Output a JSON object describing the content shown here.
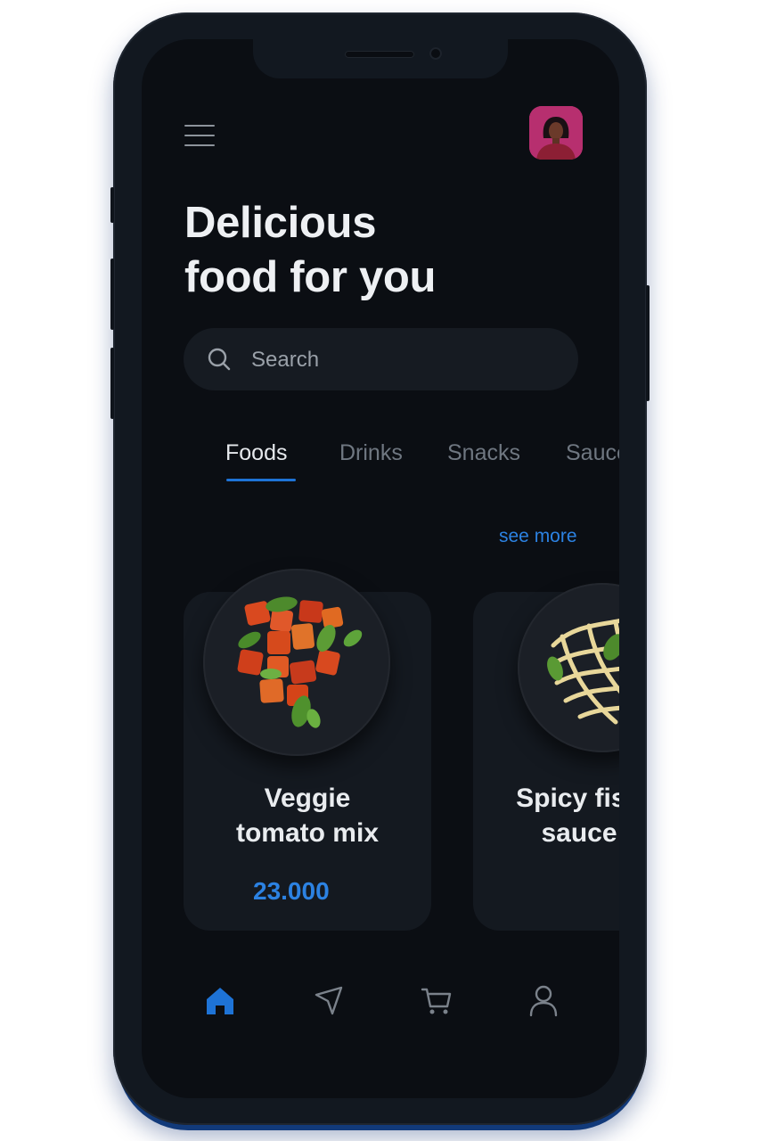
{
  "header": {
    "title_line1": "Delicious",
    "title_line2": "food for you"
  },
  "search": {
    "placeholder": "Search"
  },
  "tabs": [
    {
      "label": "Foods",
      "active": true
    },
    {
      "label": "Drinks",
      "active": false
    },
    {
      "label": "Snacks",
      "active": false
    },
    {
      "label": "Sauce",
      "active": false
    }
  ],
  "see_more": "see more",
  "products": [
    {
      "name_line1": "Veggie",
      "name_line2": "tomato mix",
      "price": "23.000",
      "image": "veggie-tomato-dish"
    },
    {
      "name_line1": "Spicy fish",
      "name_line2": "sauce",
      "image": "pasta-dish"
    }
  ],
  "bottom_nav": [
    {
      "icon": "home-icon",
      "active": true
    },
    {
      "icon": "send-icon",
      "active": false
    },
    {
      "icon": "cart-icon",
      "active": false
    },
    {
      "icon": "profile-icon",
      "active": false
    }
  ],
  "colors": {
    "accent": "#1e73d6",
    "background": "#0b0e13",
    "card": "#141920",
    "avatar_bg": "#b72f6f"
  }
}
